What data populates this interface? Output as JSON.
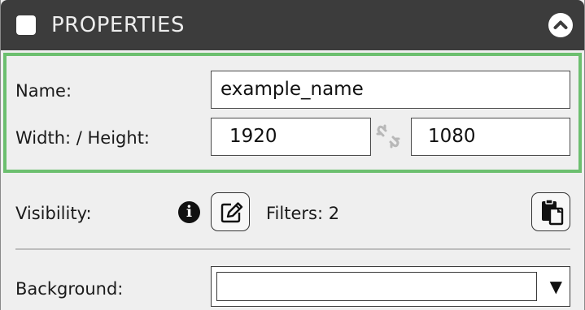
{
  "header": {
    "title": "PROPERTIES"
  },
  "properties": {
    "name_label": "Name:",
    "name_value": "example_name",
    "size_label": "Width: / Height:",
    "width_value": "1920",
    "height_value": "1080"
  },
  "visibility": {
    "label": "Visibility:",
    "info_glyph": "i",
    "filters_text": "Filters: 2"
  },
  "background": {
    "label": "Background:",
    "selected_value": "",
    "dropdown_glyph": "▼"
  },
  "colors": {
    "header_bg": "#3c3c3c",
    "highlight_border": "#6cbf6f",
    "panel_bg": "#efefef"
  }
}
